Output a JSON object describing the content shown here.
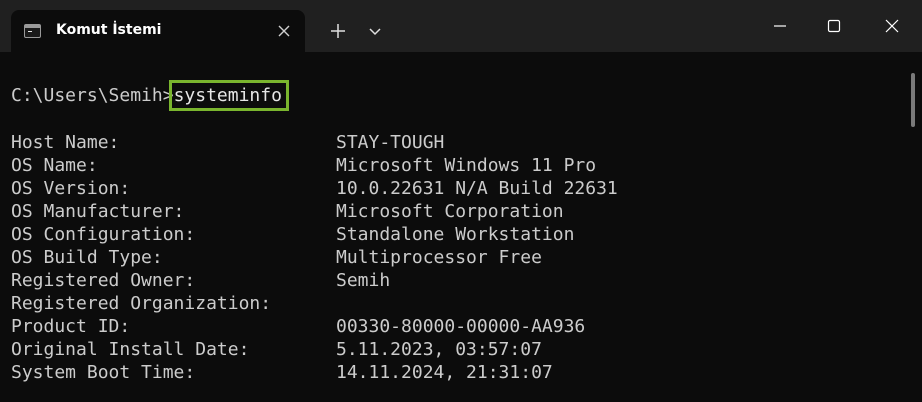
{
  "window": {
    "tab_title": "Komut İstemi",
    "tab_icon": "cmd-terminal-icon",
    "close_tab_icon": "close-icon",
    "new_tab_icon": "plus-icon",
    "dropdown_icon": "chevron-down-icon",
    "minimize_icon": "minimize-icon",
    "maximize_icon": "maximize-icon",
    "close_window_icon": "close-icon"
  },
  "terminal": {
    "prompt": "C:\\Users\\Semih>",
    "command": "systeminfo",
    "highlight_color": "#7ab52e",
    "rows": [
      {
        "label": "Host Name:",
        "value": "STAY-TOUGH"
      },
      {
        "label": "OS Name:",
        "value": "Microsoft Windows 11 Pro"
      },
      {
        "label": "OS Version:",
        "value": "10.0.22631 N/A Build 22631"
      },
      {
        "label": "OS Manufacturer:",
        "value": "Microsoft Corporation"
      },
      {
        "label": "OS Configuration:",
        "value": "Standalone Workstation"
      },
      {
        "label": "OS Build Type:",
        "value": "Multiprocessor Free"
      },
      {
        "label": "Registered Owner:",
        "value": "Semih"
      },
      {
        "label": "Registered Organization:",
        "value": ""
      },
      {
        "label": "Product ID:",
        "value": "00330-80000-00000-AA936"
      },
      {
        "label": "Original Install Date:",
        "value": "5.11.2023, 03:57:07"
      },
      {
        "label": "System Boot Time:",
        "value": "14.11.2024, 21:31:07"
      }
    ]
  }
}
